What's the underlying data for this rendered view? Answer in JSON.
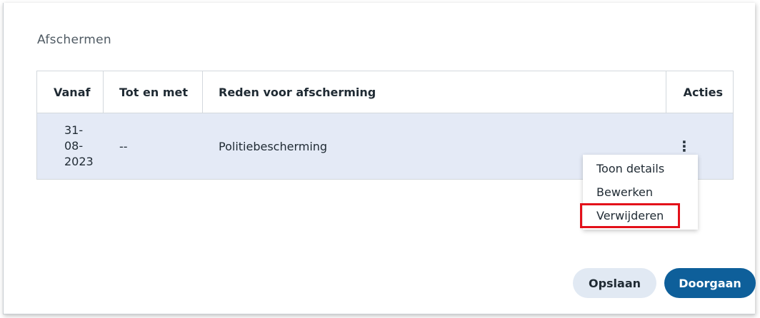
{
  "dialog": {
    "title": "Afschermen"
  },
  "table": {
    "headers": {
      "vanaf": "Vanaf",
      "tot_en_met": "Tot en met",
      "reden": "Reden voor afscherming",
      "acties": "Acties"
    },
    "rows": [
      {
        "vanaf_line1": "31-08-",
        "vanaf_line2": "2023",
        "tot_en_met": "--",
        "reden": "Politiebescherming",
        "actions_icon": "kebab-menu-icon"
      }
    ]
  },
  "row_menu": {
    "items": [
      {
        "label": "Toon details"
      },
      {
        "label": "Bewerken"
      },
      {
        "label": "Verwijderen",
        "highlighted": true
      }
    ]
  },
  "buttons": {
    "save": "Opslaan",
    "continue": "Doorgaan"
  },
  "colors": {
    "primary": "#0e5f9a",
    "row_selected": "#e4eaf6",
    "secondary_button": "#e1e9f3",
    "highlight_border": "#e3101a"
  }
}
